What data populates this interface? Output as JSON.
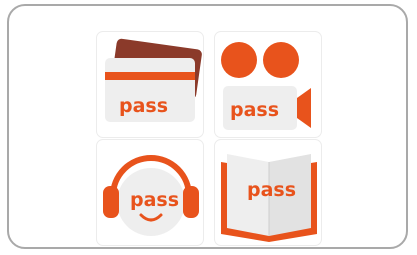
{
  "app_icons": [
    {
      "id": "card",
      "label": "pass",
      "icon": "card-pass-icon"
    },
    {
      "id": "video",
      "label": "pass",
      "icon": "video-pass-icon"
    },
    {
      "id": "music",
      "label": "pass",
      "icon": "headphones-pass-icon"
    },
    {
      "id": "book",
      "label": "pass",
      "icon": "book-pass-icon"
    }
  ],
  "colors": {
    "orange": "#e8531c",
    "dark_red": "#8b3a2a",
    "tile_gray": "#eeeeee",
    "border": "#a9a9a9"
  }
}
